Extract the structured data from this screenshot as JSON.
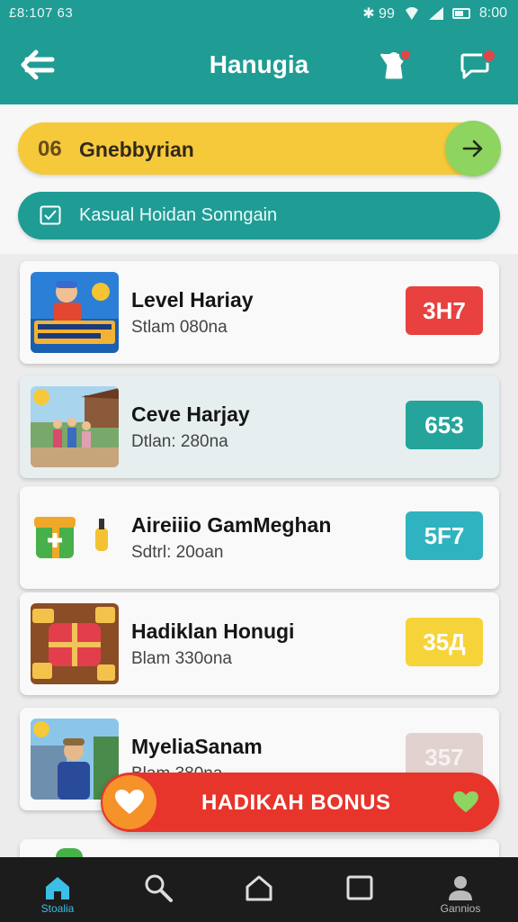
{
  "status": {
    "left_text": "£8:107  63",
    "right_icons": "✱ 99",
    "time": "8:00"
  },
  "appbar": {
    "title": "Hanugia"
  },
  "promo": {
    "number": "06",
    "label": "Gnebbyrian"
  },
  "filter": {
    "label": "Kasual Hoidan Sonngain"
  },
  "cards": [
    {
      "name": "Level Hariay",
      "sub": "Stlam 080na",
      "badge": "3H7",
      "badge_color": "#e8413f"
    },
    {
      "name": "Ceve Harjay",
      "sub": "Dtlan: 280na",
      "badge": "653",
      "badge_color": "#24a49a"
    },
    {
      "name": "Aireiiio GamMeghan",
      "sub": "Sdtrl: 20oan",
      "badge": "5F7",
      "badge_color": "#2fb3c1"
    },
    {
      "name": "Hadiklan Honugi",
      "sub": "Blam 330ona",
      "badge": "35Д",
      "badge_color": "#f7d33a"
    },
    {
      "name": "MyeliaSanam",
      "sub": "Blam 380na",
      "badge": "357",
      "badge_color": "#e2d2cf"
    }
  ],
  "bonus": {
    "label": "HADIKAH BONUS"
  },
  "nav": [
    {
      "label": "Stoalia",
      "icon": "home-icon",
      "color": "#3bbfe6"
    },
    {
      "label": "",
      "icon": "search-icon",
      "color": "#dddddd"
    },
    {
      "label": "",
      "icon": "house-outline-icon",
      "color": "#dddddd"
    },
    {
      "label": "",
      "icon": "square-icon",
      "color": "#dddddd"
    },
    {
      "label": "Gannios",
      "icon": "profile-icon",
      "color": "#bbbbbb"
    }
  ]
}
